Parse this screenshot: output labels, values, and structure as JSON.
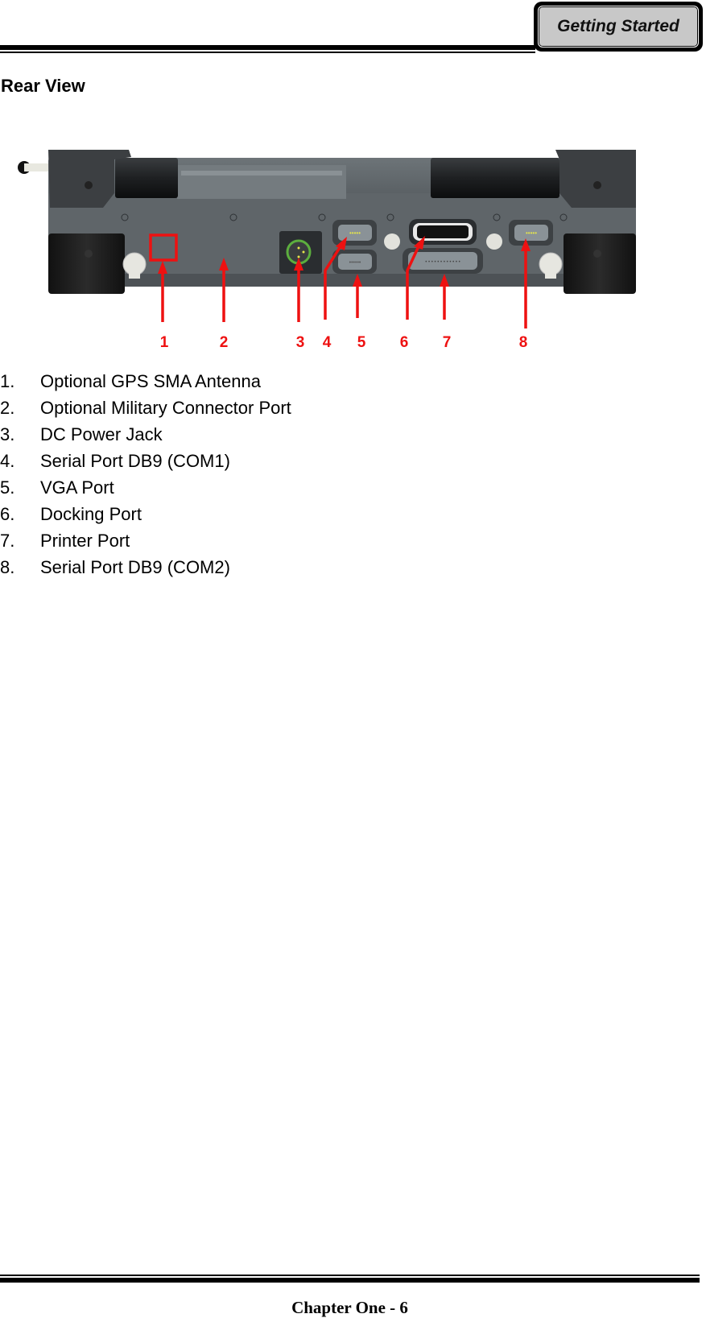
{
  "header": {
    "section_tab": "Getting Started"
  },
  "page": {
    "heading": "Rear View"
  },
  "figure": {
    "description": "Rear view of rugged notebook with port callouts",
    "callout_color": "#ee1111",
    "callouts": [
      "1",
      "2",
      "3",
      "4",
      "5",
      "6",
      "7",
      "8"
    ]
  },
  "port_list": [
    {
      "num": "1.",
      "label": "Optional GPS SMA Antenna"
    },
    {
      "num": "2.",
      "label": "Optional Military Connector Port"
    },
    {
      "num": "3.",
      "label": "DC Power Jack"
    },
    {
      "num": "4.",
      "label": "Serial Port DB9 (COM1)"
    },
    {
      "num": "5.",
      "label": "VGA Port"
    },
    {
      "num": "6.",
      "label": "Docking Port"
    },
    {
      "num": "7.",
      "label": "Printer Port"
    },
    {
      "num": "8.",
      "label": "Serial Port DB9 (COM2)"
    }
  ],
  "footer": {
    "page_label": "Chapter One - 6"
  }
}
